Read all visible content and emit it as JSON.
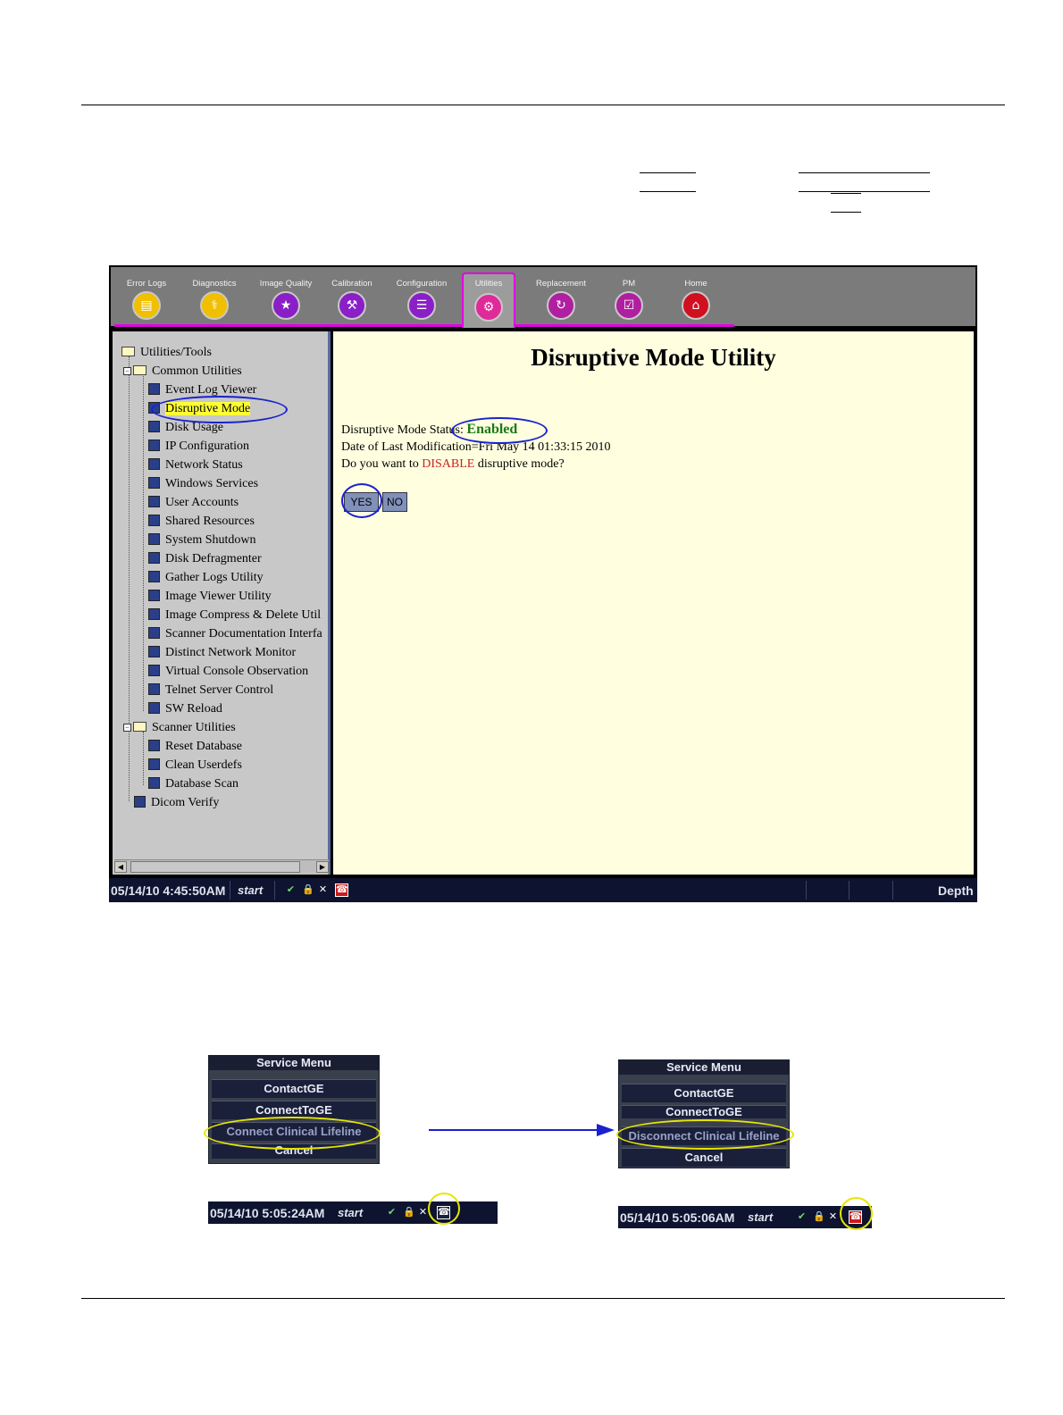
{
  "app": {
    "tabs": [
      {
        "label": "Error Logs",
        "icon": "error-logs-icon",
        "color": "#f0c000"
      },
      {
        "label": "Diagnostics",
        "icon": "stethoscope-icon",
        "color": "#f0c000"
      },
      {
        "label": "Image Quality",
        "icon": "image-quality-icon",
        "color": "#8a1fc8"
      },
      {
        "label": "Calibration",
        "icon": "calibration-icon",
        "color": "#8a1fc8"
      },
      {
        "label": "Configuration",
        "icon": "configuration-icon",
        "color": "#8a1fc8"
      },
      {
        "label": "Utilities",
        "icon": "utilities-icon",
        "color": "#e02a9a"
      },
      {
        "label": "Replacement",
        "icon": "replacement-icon",
        "color": "#b01fa0"
      },
      {
        "label": "PM",
        "icon": "pm-icon",
        "color": "#b01fa0"
      },
      {
        "label": "Home",
        "icon": "home-icon",
        "color": "#d01020"
      }
    ],
    "active_tab": "Utilities",
    "tree": {
      "root": "Utilities/Tools",
      "common_utilities": "Common Utilities",
      "common_items": [
        "Event Log Viewer",
        "Disruptive Mode",
        "Disk Usage",
        "IP Configuration",
        "Network Status",
        "Windows Services",
        "User Accounts",
        "Shared Resources",
        "System Shutdown",
        "Disk Defragmenter",
        "Gather Logs Utility",
        "Image Viewer Utility",
        "Image Compress & Delete Util",
        "Scanner Documentation Interfa",
        "Distinct Network Monitor",
        "Virtual Console Observation",
        "Telnet Server Control",
        "SW Reload"
      ],
      "scanner_utilities": "Scanner Utilities",
      "scanner_items": [
        "Reset Database",
        "Clean Userdefs",
        "Database Scan"
      ],
      "dicom": "Dicom Verify",
      "selected": "Disruptive Mode"
    },
    "content": {
      "title": "Disruptive Mode Utility",
      "status_label": "Disruptive Mode Status:",
      "status_value": "Enabled",
      "modified": "Date of Last Modification=Fri May 14 01:33:15 2010",
      "question_pre": "Do you want to",
      "question_action": "DISABLE",
      "question_post": "disruptive mode?",
      "yes": "YES",
      "no": "NO"
    },
    "taskbar": {
      "datetime": "05/14/10 4:45:50AM",
      "start": "start",
      "right_label": "Depth"
    }
  },
  "before": {
    "menu_title": "Service Menu",
    "items": [
      "ContactGE",
      "ConnectToGE",
      "Connect Clinical Lifeline",
      "Cancel"
    ],
    "datetime": "05/14/10 5:05:24AM",
    "start": "start"
  },
  "after": {
    "menu_title": "Service Menu",
    "items": [
      "ContactGE",
      "ConnectToGE",
      "Disconnect Clinical Lifeline",
      "Cancel"
    ],
    "datetime": "05/14/10 5:05:06AM",
    "start": "start"
  }
}
